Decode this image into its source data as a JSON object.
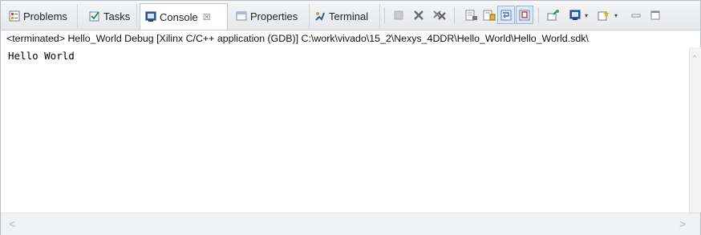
{
  "tabs": [
    {
      "label": "Problems"
    },
    {
      "label": "Tasks"
    },
    {
      "label": "Console",
      "close": "☒"
    },
    {
      "label": "Properties"
    },
    {
      "label": "Terminal"
    }
  ],
  "status_line": "<terminated> Hello_World Debug [Xilinx C/C++ application (GDB)] C:\\work\\vivado\\15_2\\Nexys_4DDR\\Hello_World\\Hello_World.sdk\\",
  "console_output": "Hello World",
  "toolbar": {
    "icons": [
      "terminate-icon",
      "remove-launch-icon",
      "remove-all-terminated-icon",
      "clear-console-icon",
      "scroll-lock-icon",
      "word-wrap-icon",
      "show-on-stdout-icon",
      "pin-console-icon",
      "display-selected-console-icon",
      "open-console-icon",
      "minimize-icon",
      "maximize-icon"
    ],
    "caret": "▾",
    "minimize_glyph": "▭",
    "maximize_glyph": "□"
  },
  "scrollbar": {
    "left": "<",
    "right": ">",
    "up": "^"
  }
}
